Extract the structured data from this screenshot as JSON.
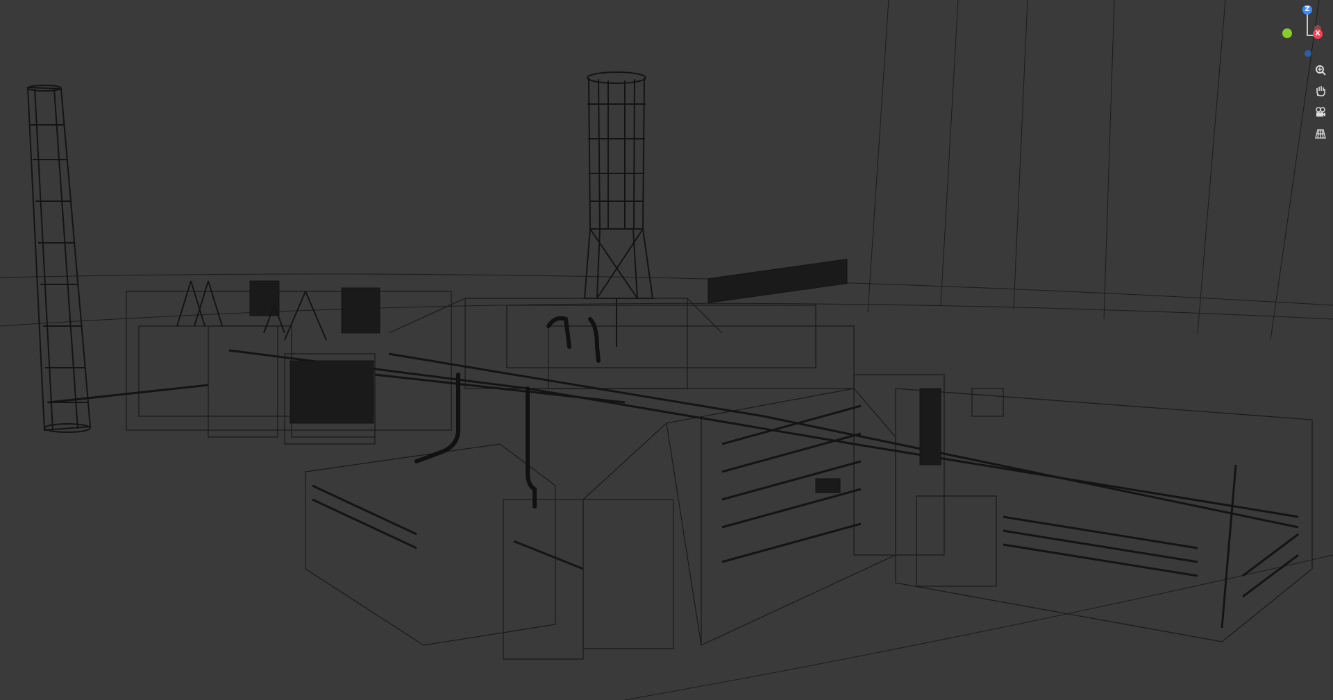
{
  "viewport": {
    "mode": "wireframe",
    "background_color": "#3a3a3a",
    "wire_color": "#141414"
  },
  "gizmo": {
    "z_label": "Z",
    "x_label": "X",
    "y_label": "",
    "z_color": "#3d8bff",
    "x_color": "#ff3b4e",
    "y_color": "#88cc2a"
  },
  "toolbar": {
    "items": [
      {
        "name": "zoom-icon"
      },
      {
        "name": "pan-hand-icon"
      },
      {
        "name": "camera-view-icon"
      },
      {
        "name": "perspective-grid-icon"
      }
    ]
  }
}
